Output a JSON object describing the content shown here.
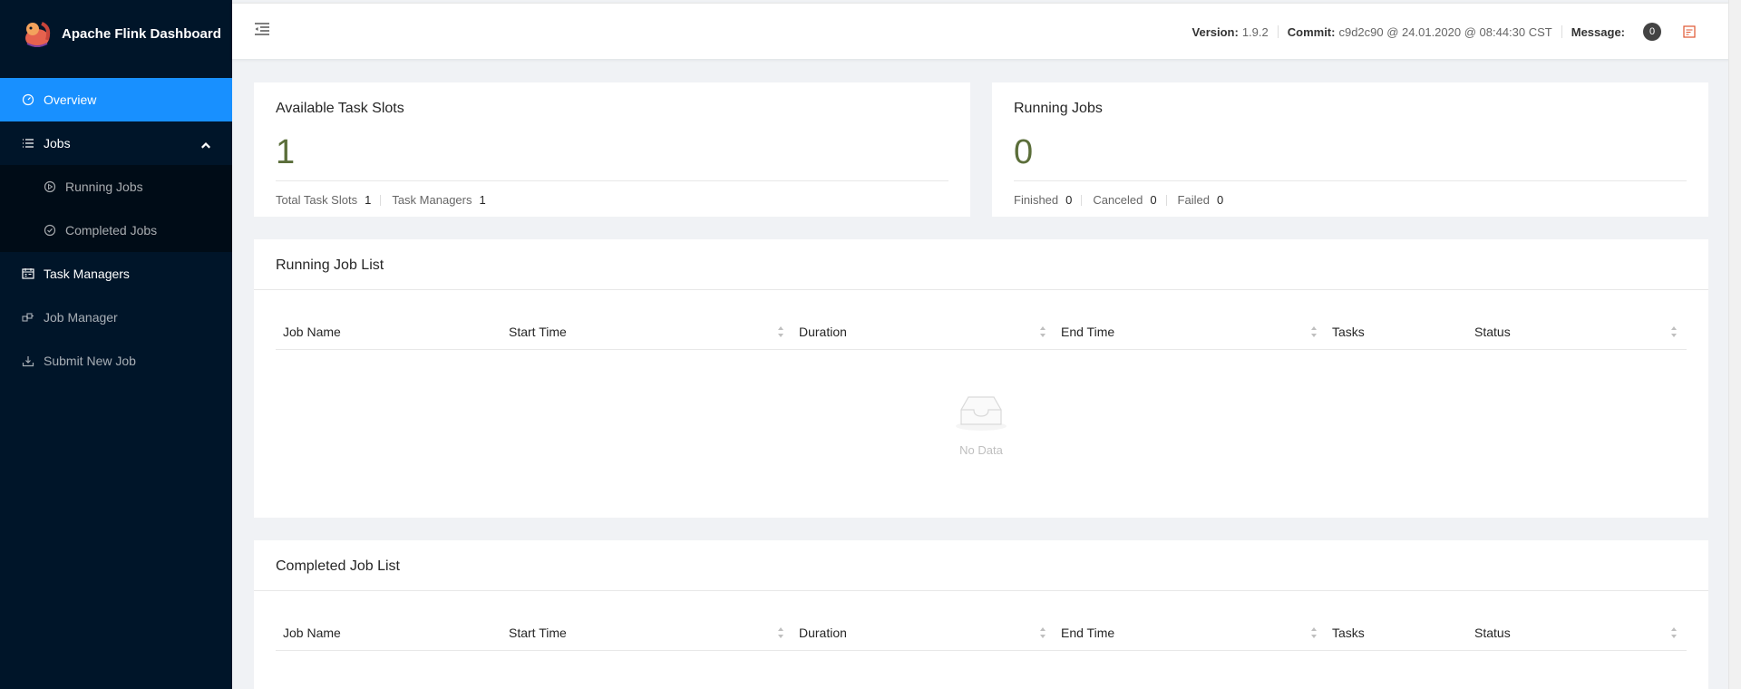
{
  "app": {
    "title": "Apache Flink Dashboard"
  },
  "sidebar": {
    "items": [
      {
        "label": "Overview",
        "icon": "dashboard-icon"
      },
      {
        "label": "Jobs",
        "icon": "list-icon"
      },
      {
        "label": "Running Jobs",
        "icon": "play-circle-icon"
      },
      {
        "label": "Completed Jobs",
        "icon": "check-circle-icon"
      },
      {
        "label": "Task Managers",
        "icon": "schedule-icon"
      },
      {
        "label": "Job Manager",
        "icon": "cluster-icon"
      },
      {
        "label": "Submit New Job",
        "icon": "upload-icon"
      }
    ]
  },
  "header": {
    "version_label": "Version:",
    "version": "1.9.2",
    "commit_label": "Commit:",
    "commit": "c9d2c90 @ 24.01.2020 @ 08:44:30 CST",
    "message_label": "Message:",
    "message_count": "0"
  },
  "slots": {
    "title": "Available Task Slots",
    "value": "1",
    "total_label": "Total Task Slots",
    "total": "1",
    "tm_label": "Task Managers",
    "tm": "1"
  },
  "running": {
    "title": "Running Jobs",
    "value": "0",
    "finished_label": "Finished",
    "finished": "0",
    "canceled_label": "Canceled",
    "canceled": "0",
    "failed_label": "Failed",
    "failed": "0"
  },
  "running_list": {
    "title": "Running Job List",
    "columns": [
      "Job Name",
      "Start Time",
      "Duration",
      "End Time",
      "Tasks",
      "Status"
    ],
    "empty": "No Data"
  },
  "completed_list": {
    "title": "Completed Job List",
    "columns": [
      "Job Name",
      "Start Time",
      "Duration",
      "End Time",
      "Tasks",
      "Status"
    ]
  },
  "colors": {
    "sidebar": "#001529",
    "accent": "#1890ff",
    "submenu": "#000c17"
  }
}
